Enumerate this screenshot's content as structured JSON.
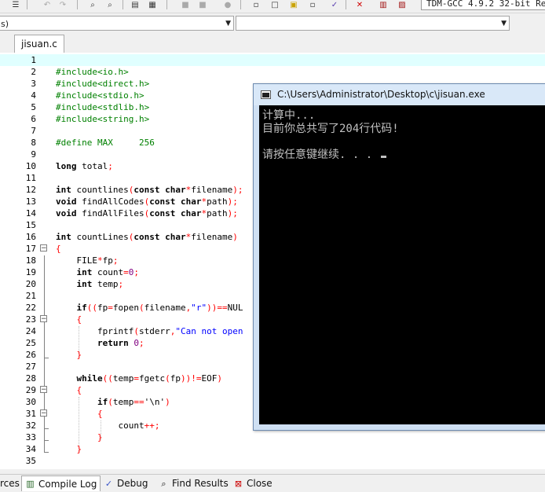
{
  "toolbar": {
    "compiler": "TDM-GCC 4.9.2 32-bit Re"
  },
  "combos": {
    "class_value": "s)",
    "members_value": ""
  },
  "editor": {
    "tab_label": "jisuan.c",
    "lines": [
      {
        "n": "1"
      },
      {
        "n": "2"
      },
      {
        "n": "3"
      },
      {
        "n": "4"
      },
      {
        "n": "5"
      },
      {
        "n": "6"
      },
      {
        "n": "7"
      },
      {
        "n": "8"
      },
      {
        "n": "9"
      },
      {
        "n": "10"
      },
      {
        "n": "11"
      },
      {
        "n": "12"
      },
      {
        "n": "13"
      },
      {
        "n": "14"
      },
      {
        "n": "15"
      },
      {
        "n": "16"
      },
      {
        "n": "17"
      },
      {
        "n": "18"
      },
      {
        "n": "19"
      },
      {
        "n": "20"
      },
      {
        "n": "21"
      },
      {
        "n": "22"
      },
      {
        "n": "23"
      },
      {
        "n": "24"
      },
      {
        "n": "25"
      },
      {
        "n": "26"
      },
      {
        "n": "27"
      },
      {
        "n": "28"
      },
      {
        "n": "29"
      },
      {
        "n": "30"
      },
      {
        "n": "31"
      },
      {
        "n": "32"
      },
      {
        "n": "33"
      },
      {
        "n": "34"
      },
      {
        "n": "35"
      }
    ],
    "code": {
      "l2": "#include<io.h>",
      "l3": "#include<direct.h>",
      "l4": "#include<stdio.h>",
      "l5": "#include<stdlib.h>",
      "l6": "#include<string.h>",
      "l8": "#define MAX     256",
      "l10_kw": "long",
      "l10_rest": " total",
      "l12_kw": "int",
      "l12_name": " countlines",
      "l12_kw2": "const char",
      "l12_rest": "filename",
      "l13_kw": "void",
      "l13_name": " findAllCodes",
      "l13_kw2": "const char",
      "l13_rest": "path",
      "l14_kw": "void",
      "l14_name": " findAllFiles",
      "l14_kw2": "const char",
      "l14_rest": "path",
      "l16_kw": "int",
      "l16_name": " countLines",
      "l16_kw2": "const char",
      "l16_rest": "filename",
      "l18_a": "FILE",
      "l18_b": "fp",
      "l19_kw": "int",
      "l19_a": " count",
      "l19_num": "0",
      "l20_kw": "int",
      "l20_a": " temp",
      "l22_kw": "if",
      "l22_a": "fp",
      "l22_b": "fopen",
      "l22_c": "filename",
      "l22_str": "\"r\"",
      "l22_d": "NUL",
      "l24_a": "fprintf",
      "l24_b": "stderr",
      "l24_str": "\"Can not open",
      "l25_kw": "return",
      "l25_num": " 0",
      "l28_kw": "while",
      "l28_a": "temp",
      "l28_b": "fgetc",
      "l28_c": "fp",
      "l28_d": "EOF",
      "l30_kw": "if",
      "l30_a": "temp",
      "l30_b": "'\\n'",
      "l32_a": "count"
    }
  },
  "console": {
    "title": "C:\\Users\\Administrator\\Desktop\\c\\jisuan.exe",
    "line1": "计算中...",
    "line2": "目前你总共写了204行代码!",
    "line3": "请按任意键继续. . . "
  },
  "bottom_tabs": {
    "resources": "rces",
    "compile_log": "Compile Log",
    "debug": "Debug",
    "find_results": "Find Results",
    "close": "Close"
  }
}
